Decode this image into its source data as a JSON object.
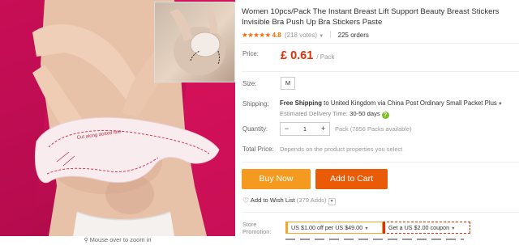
{
  "gallery": {
    "zoom_hint": "Mouse over to zoom in",
    "sticker_text": "Cut along dotted line"
  },
  "product": {
    "title": "Women 10pcs/Pack The Instant Breast Lift Support Beauty Breast Stickers Invisible Bra Push Up Bra Stickers Paste",
    "rating_value": "4.8",
    "stars": "★★★★★",
    "votes": "(218 votes)",
    "orders": "225 orders"
  },
  "price": {
    "label": "Price:",
    "amount": "£ 0.61",
    "unit": "/ Pack"
  },
  "size": {
    "label": "Size:",
    "selected": "M"
  },
  "shipping": {
    "label": "Shipping:",
    "free_text": "Free Shipping",
    "to_text": "to United Kingdom via China Post Ordinary Small Packet Plus",
    "delivery_label": "Estimated Delivery Time:",
    "delivery_days": "30-50 days"
  },
  "quantity": {
    "label": "Quantity:",
    "minus": "−",
    "value": "1",
    "plus": "+",
    "available": "Pack (7856 Packs available)"
  },
  "total": {
    "label": "Total Price:",
    "note": "Depends on the product properties you select"
  },
  "actions": {
    "buy_now": "Buy Now",
    "add_to_cart": "Add to Cart",
    "wishlist": "Add to Wish List",
    "wishlist_count": "(379 Adds)"
  },
  "promotion": {
    "label_line1": "Store",
    "label_line2": "Promotion:",
    "coupon_a": "US $1.00 off per US $49.00",
    "coupon_b": "Get a US $2.00 coupon"
  },
  "colors": {
    "accent_orange": "#f39a1f",
    "cart_orange": "#ea5b08",
    "price_red": "#e62e04",
    "star_orange": "#ff6600",
    "background_pink": "#e0125f"
  }
}
